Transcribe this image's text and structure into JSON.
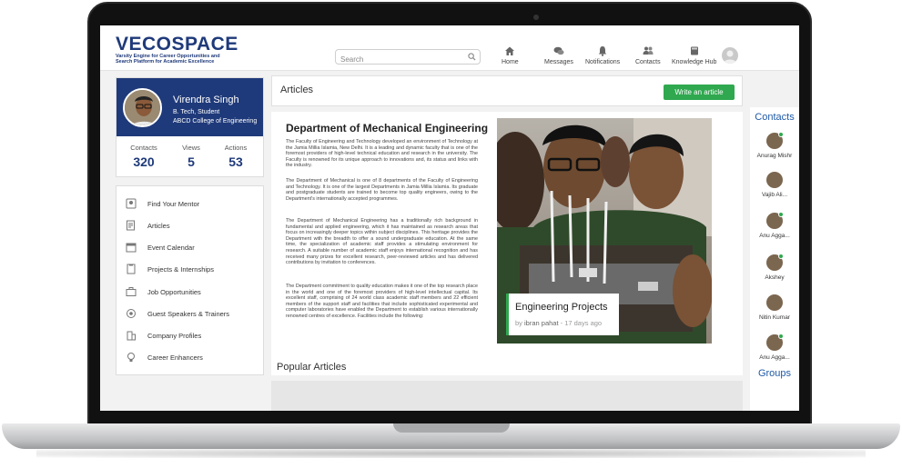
{
  "header": {
    "logo_title": "VECOSPACE",
    "logo_tagline": "Varsity Engine for Career Opportunities and Search Platform for Academic Excellence",
    "search_placeholder": "Search",
    "nav": [
      {
        "label": "Home",
        "icon": "home-icon"
      },
      {
        "label": "Messages",
        "icon": "messages-icon"
      },
      {
        "label": "Notifications",
        "icon": "bell-icon"
      },
      {
        "label": "Contacts",
        "icon": "contacts-icon"
      },
      {
        "label": "Knowledge Hub",
        "icon": "book-icon"
      }
    ]
  },
  "profile": {
    "name": "Virendra Singh",
    "degree": "B. Tech, Student",
    "college": "ABCD College of Engineering",
    "stats": [
      {
        "label": "Contacts",
        "value": "320"
      },
      {
        "label": "Views",
        "value": "5"
      },
      {
        "label": "Actions",
        "value": "53"
      }
    ]
  },
  "menu": [
    {
      "label": "Find Your Mentor",
      "icon": "mentor-icon"
    },
    {
      "label": "Articles",
      "icon": "articles-icon"
    },
    {
      "label": "Event Calendar",
      "icon": "calendar-icon"
    },
    {
      "label": "Projects & Internships",
      "icon": "projects-icon"
    },
    {
      "label": "Job Opportunities",
      "icon": "briefcase-icon"
    },
    {
      "label": "Guest Speakers & Trainers",
      "icon": "speaker-icon"
    },
    {
      "label": "Company Profiles",
      "icon": "building-icon"
    },
    {
      "label": "Career Enhancers",
      "icon": "bulb-icon"
    }
  ],
  "articles": {
    "title": "Articles",
    "write_button": "Write an article",
    "heading": "Department of Mechanical Engineering",
    "paragraphs": [
      "The Faculty of Engineering and Technology developed an environment of Technology at the Jamia Millia Islamia, New Delhi. It is a leading and dynamic faculty that is one of the foremost providers of high-level technical education and research in the university. The Faculty is renowned for its unique approach to innovations and, its status and links with the industry.",
      "The Department of Mechanical is one of 8 departments of the Faculty of Engineering and Technology. It is one of the largest Departments in Jamia Millia Islamia. Its graduate and postgraduate students are trained to become top quality engineers, owing to the Department's internationally accepted programmes.",
      "The Department of Mechanical Engineering has a traditionally rich background in fundamental and applied engineering, which it has maintained as research areas that focus on increasingly deeper topics within subject disciplines. This heritage provides the Department with the breadth to offer a sound undergraduate education. At the same time, the specialization of academic staff provides a stimulating environment for research. A suitable number of academic staff enjoys international recognition and has received many prizes for excellent research, peer-reviewed articles and has delivered contributions by invitation to conferences.",
      "The Department commitment to quality education makes it one of the top research place in the world and one of the foremost providers of high-level intellectual capital. Its excellent staff, comprising of 24 world class academic staff members and 22 efficient members of the support staff and facilities that include sophisticated experimental and computer laboratories have enabled the Department to establish various internationally renowned centres of excellence. Facilities include the following:"
    ],
    "caption_title": "Engineering Projects",
    "caption_by": "by",
    "caption_author": "ibran pahat",
    "caption_time": " - 17 days ago",
    "popular_title": "Popular Articles"
  },
  "contacts": {
    "title": "Contacts",
    "groups_title": "Groups",
    "items": [
      {
        "name": "Anurag Mishr",
        "online": true
      },
      {
        "name": "Vajib Ali...",
        "online": false
      },
      {
        "name": "Anu Agga...",
        "online": true
      },
      {
        "name": "Akshey",
        "online": true
      },
      {
        "name": "Nitin Kumar",
        "online": false
      },
      {
        "name": "Anu Agga...",
        "online": true
      }
    ]
  },
  "colors": {
    "brand_blue": "#1f3a7a",
    "accent_green": "#2fa84f",
    "link_blue": "#1f5aa8"
  }
}
